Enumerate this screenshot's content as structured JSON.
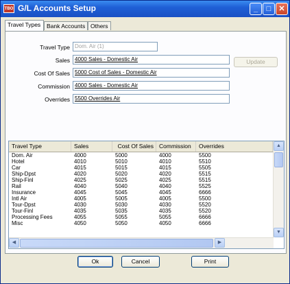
{
  "window": {
    "title": "G/L Accounts Setup",
    "app_icon_text": "TBO"
  },
  "tabs": [
    "Travel Types",
    "Bank Accounts",
    "Others"
  ],
  "form": {
    "travel_type_label": "Travel Type",
    "travel_type_value": "Dom. Air (1)",
    "sales_label": "Sales",
    "sales_value": "4000 Sales - Domestic Air",
    "cost_label": "Cost Of Sales",
    "cost_value": "5000 Cost of Sales - Domestic Air",
    "commission_label": "Commission",
    "commission_value": "4000 Sales - Domestic Air",
    "overrides_label": "Overrides",
    "overrides_value": "5500 Overrides Air",
    "update_label": "Update"
  },
  "grid": {
    "columns": [
      "Travel Type",
      "Sales",
      "Cost Of Sales",
      "Commission",
      "Overrides"
    ],
    "rows": [
      [
        "Dom. Air",
        "4000",
        "5000",
        "4000",
        "5500"
      ],
      [
        "Hotel",
        "4010",
        "5010",
        "4010",
        "5510"
      ],
      [
        "Car",
        "4015",
        "5015",
        "4015",
        "5505"
      ],
      [
        "Ship-Dpst",
        "4020",
        "5020",
        "4020",
        "5515"
      ],
      [
        "Ship-Finl",
        "4025",
        "5025",
        "4025",
        "5515"
      ],
      [
        "Rail",
        "4040",
        "5040",
        "4040",
        "5525"
      ],
      [
        "Insurance",
        "4045",
        "5045",
        "4045",
        "6666"
      ],
      [
        "Intl Air",
        "4005",
        "5005",
        "4005",
        "5500"
      ],
      [
        "Tour-Dpst",
        "4030",
        "5030",
        "4030",
        "5520"
      ],
      [
        "Tour-Finl",
        "4035",
        "5035",
        "4035",
        "5520"
      ],
      [
        "Processing Fees",
        "4055",
        "5055",
        "5055",
        "6666"
      ],
      [
        "Misc",
        "4050",
        "5050",
        "4050",
        "6666"
      ]
    ]
  },
  "footer": {
    "ok_label": "Ok",
    "cancel_label": "Cancel",
    "print_label": "Print"
  },
  "titlebar_buttons": {
    "minimize": "_",
    "maximize": "□",
    "close": "✕"
  },
  "scroll_glyphs": {
    "up": "▲",
    "down": "▼",
    "left": "◀",
    "right": "▶"
  }
}
